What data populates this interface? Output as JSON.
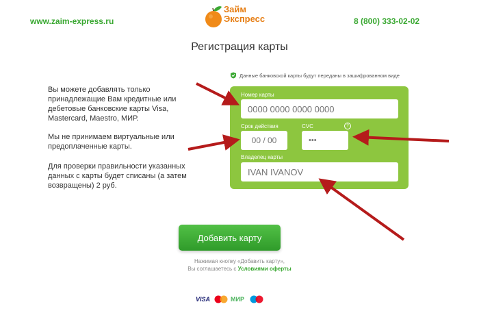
{
  "header": {
    "site_url": "www.zaim-express.ru",
    "logo_name": "Займ",
    "logo_sub": "Экспресс",
    "phone": "8 (800) 333-02-02"
  },
  "page_title": "Регистрация карты",
  "secure_note": "Данные банковской карты будут переданы в зашифрованном виде",
  "info": {
    "p1": "Вы можете добавлять только принадлежащие Вам кредитные или дебетовые банковские карты Visa, Mastercard, Maestro, МИР.",
    "p2": "Мы не принимаем виртуальные или предоплаченные карты.",
    "p3": "Для проверки правильности указанных данных с карты будет списаны (а затем возвращены) 2 руб."
  },
  "form": {
    "card_number_label": "Номер карты",
    "card_number_placeholder": "0000 0000 0000 0000",
    "expiry_label": "Срок действия",
    "expiry_placeholder": "00 / 00",
    "cvc_label": "CVC",
    "cvc_placeholder": "•••",
    "help": "?",
    "owner_label": "Владелец карты",
    "owner_placeholder": "IVAN IVANOV"
  },
  "submit_button": "Добавить карту",
  "agreement": {
    "line1": "Нажимая кнопку «Добавить карту»,",
    "line2_prefix": "Вы соглашаетесь с ",
    "link": "Условиями оферты"
  },
  "payment_logos": {
    "visa": "VISA",
    "mir": "МИР"
  },
  "colors": {
    "brand_green": "#3aa832",
    "card_green": "#8dc63f",
    "logo_orange": "#e67e14",
    "arrow_red": "#b51b1b"
  },
  "icons": [
    "orange-logo-icon",
    "shield-check-icon",
    "help-icon",
    "mastercard-icon",
    "maestro-icon",
    "arrow-annotation"
  ]
}
